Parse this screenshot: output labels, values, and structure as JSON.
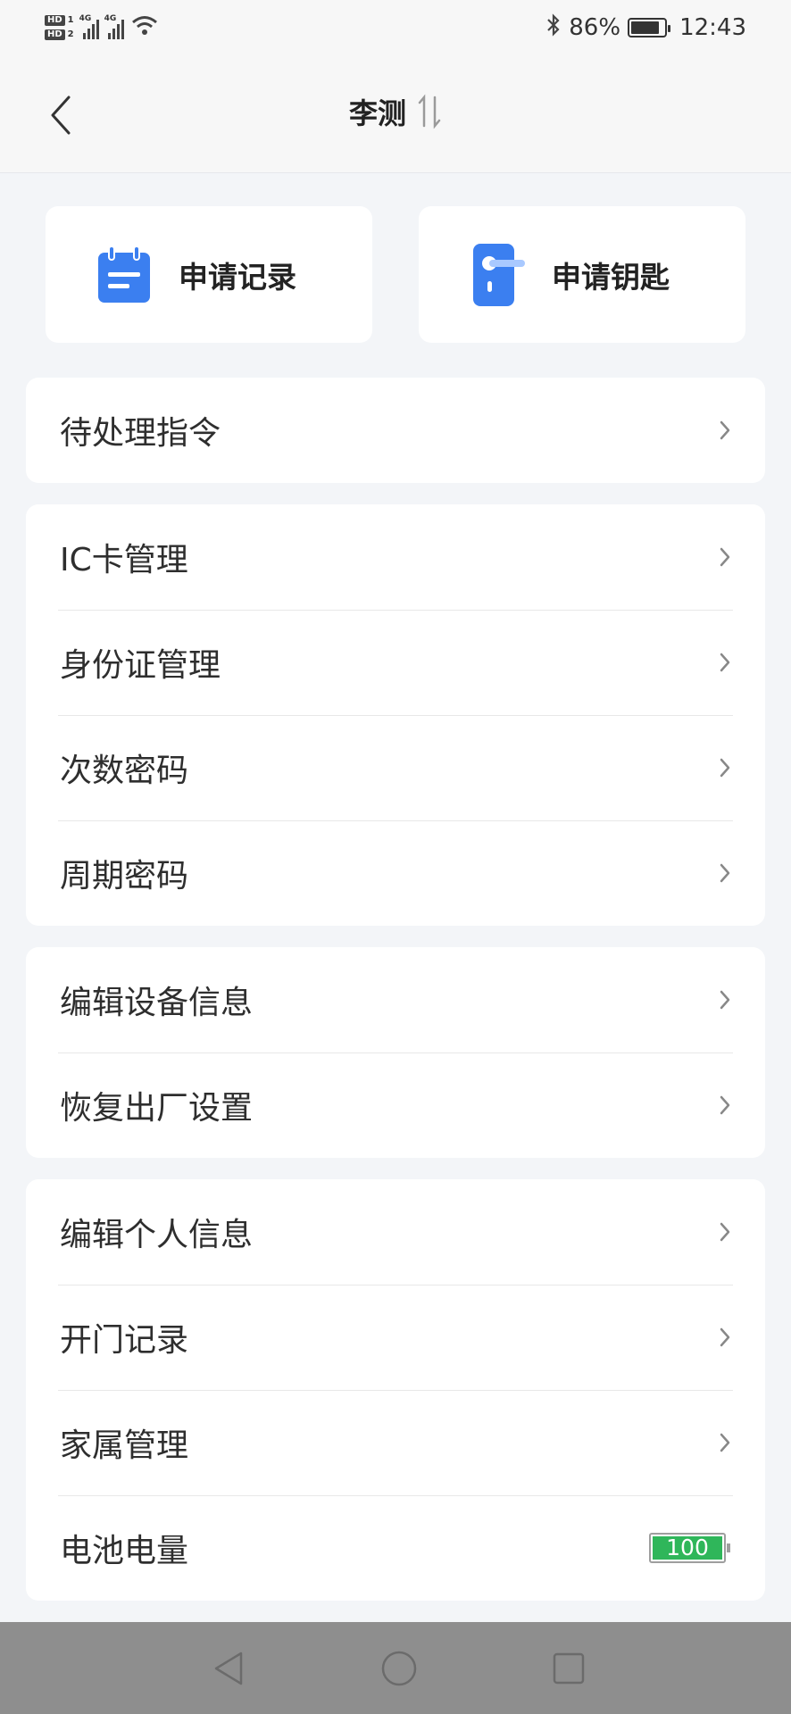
{
  "status_bar": {
    "hd1": "HD",
    "hd1_num": "1",
    "hd2": "HD",
    "hd2_num": "2",
    "net1": "4G",
    "net2": "4G",
    "battery_percent": "86%",
    "battery_level": 0.86,
    "time": "12:43"
  },
  "header": {
    "title": "李测",
    "back_icon": "chevron-left-icon",
    "sort_icon": "sort-arrows-icon"
  },
  "quick_actions": [
    {
      "label": "申请记录",
      "icon": "calendar-list-icon"
    },
    {
      "label": "申请钥匙",
      "icon": "door-key-icon"
    }
  ],
  "groups": {
    "pending": [
      "待处理指令"
    ],
    "credentials": [
      "IC卡管理",
      "身份证管理",
      "次数密码",
      "周期密码"
    ],
    "device": [
      "编辑设备信息",
      "恢复出厂设置"
    ],
    "personal": [
      "编辑个人信息",
      "开门记录",
      "家属管理"
    ],
    "battery_label": "电池电量",
    "battery_value": "100"
  },
  "colors": {
    "accent_blue": "#3b7ff0",
    "battery_green": "#2fb65a",
    "background": "#f3f5f8"
  }
}
